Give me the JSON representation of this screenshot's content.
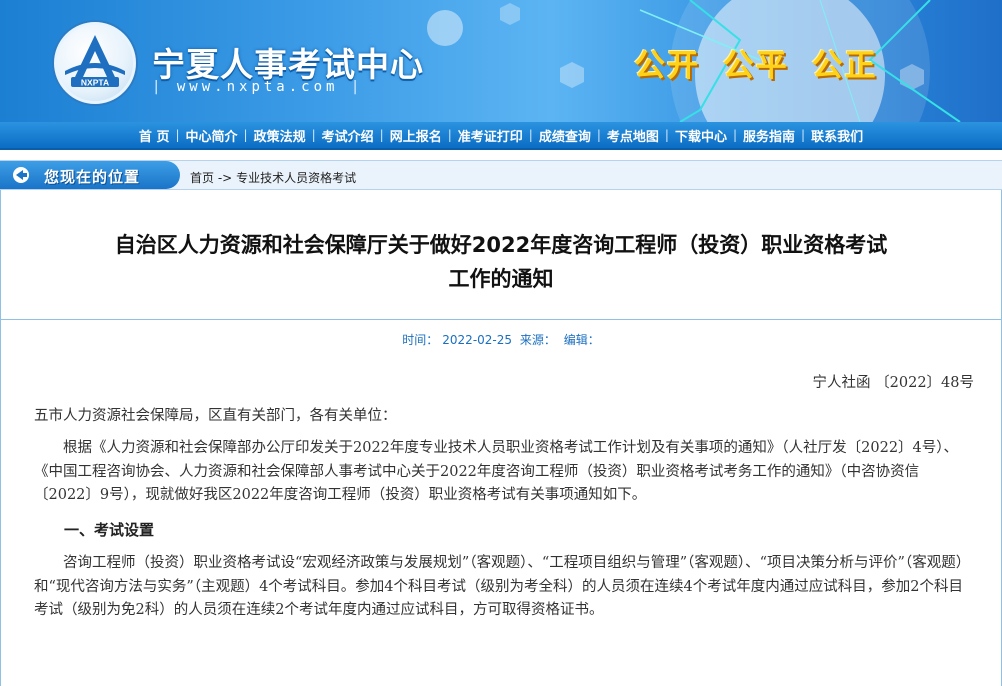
{
  "header": {
    "logo_text": "NXPTA",
    "site_name": "宁夏人事考试中心",
    "site_url": "www.nxpta.com",
    "slogan": "公开 公平 公正"
  },
  "nav": {
    "items": [
      "首 页",
      "中心简介",
      "政策法规",
      "考试介绍",
      "网上报名",
      "准考证打印",
      "成绩查询",
      "考点地图",
      "下载中心",
      "服务指南",
      "联系我们"
    ]
  },
  "location": {
    "label": "您现在的位置",
    "home": "首页",
    "arrow": "->",
    "current": "专业技术人员资格考试"
  },
  "article": {
    "title_line1": "自治区人力资源和社会保障厅关于做好2022年度咨询工程师（投资）职业资格考试",
    "title_line2": "工作的通知",
    "meta": {
      "time_label": "时间：",
      "time": "2022-02-25",
      "source_label": "来源：",
      "editor_label": "编辑："
    },
    "doc_number": "宁人社函 〔2022〕48号",
    "addressee": "五市人力资源社会保障局，区直有关部门，各有关单位：",
    "paragraph1": "根据《人力资源和社会保障部办公厅印发关于2022年度专业技术人员职业资格考试工作计划及有关事项的通知》（人社厅发〔2022〕4号）、《中国工程咨询协会、人力资源和社会保障部人事考试中心关于2022年度咨询工程师（投资）职业资格考试考务工作的通知》（中咨协资信〔2022〕9号），现就做好我区2022年度咨询工程师（投资）职业资格考试有关事项通知如下。",
    "section1_title": "一、考试设置",
    "paragraph2": "咨询工程师（投资）职业资格考试设“宏观经济政策与发展规划”（客观题）、“工程项目组织与管理”（客观题）、“项目决策分析与评价”（客观题）和“现代咨询方法与实务”（主观题）4个考试科目。参加4个科目考试（级别为考全科）的人员须在连续4个考试年度内通过应试科目，参加2个科目考试（级别为免2科）的人员须在连续2个考试年度内通过应试科目，方可取得资格证书。"
  },
  "colors": {
    "banner_blue": "#3a9ae6",
    "nav_blue": "#0b6dc4",
    "slogan_yellow": "#ffd21a",
    "meta_blue": "#1a6fc0"
  }
}
